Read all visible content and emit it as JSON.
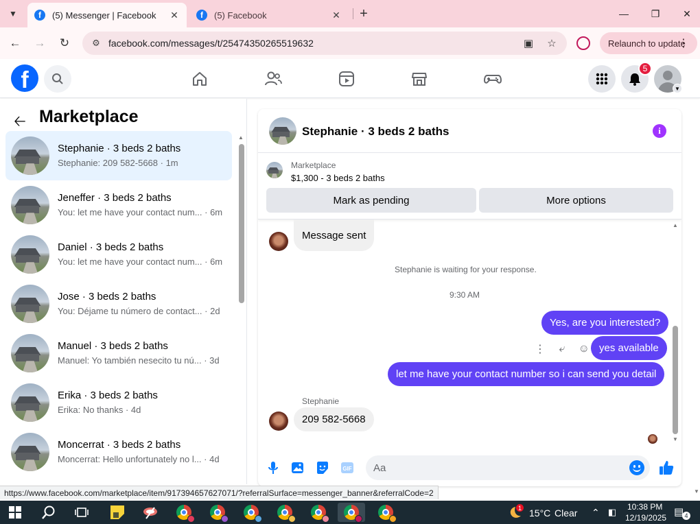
{
  "browser": {
    "tabs": [
      {
        "title": "(5) Messenger | Facebook",
        "active": true
      },
      {
        "title": "(5) Facebook",
        "active": false
      }
    ],
    "url": "facebook.com/messages/t/25474350265519632",
    "relaunch_label": "Relaunch to update",
    "status_url": "https://www.facebook.com/marketplace/item/917394657627071/?referralSurface=messenger_banner&referralCode=2"
  },
  "fbnav": {
    "logo_letter": "f",
    "notifications_count": "5",
    "brand_color": "#0866ff"
  },
  "left": {
    "title": "Marketplace",
    "conversations": [
      {
        "name": "Stephanie · 3 beds 2 baths",
        "preview": "Stephanie: 209 582-5668 · 1m",
        "selected": true
      },
      {
        "name": "Jeneffer · 3 beds 2 baths",
        "preview": "You: let me have your contact num... · 6m"
      },
      {
        "name": "Daniel · 3 beds 2 baths",
        "preview": "You: let me have your contact num... · 6m"
      },
      {
        "name": "Jose · 3 beds 2 baths",
        "preview": "You: Déjame tu número de contact... · 2d"
      },
      {
        "name": "Manuel · 3 beds 2 baths",
        "preview": "Manuel: Yo también nesecito tu nú... · 3d"
      },
      {
        "name": "Erika · 3 beds 2 baths",
        "preview": "Erika: No thanks · 4d"
      },
      {
        "name": "Moncerrat · 3 beds 2 baths",
        "preview": "Moncerrat: Hello unfortunately no l... · 4d"
      }
    ]
  },
  "chat": {
    "title": "Stephanie · 3 beds 2 baths",
    "marketplace": {
      "source": "Marketplace",
      "price_line": "$1,300 - 3 beds 2 baths",
      "mark_pending_label": "Mark as pending",
      "more_options_label": "More options"
    },
    "messages": {
      "in1": "Message sent",
      "waiting": "Stephanie is waiting for your response.",
      "time": "9:30 AM",
      "out1": "Yes, are you interested?",
      "out2": "yes available",
      "out3": "let me have your contact number so i can send you detail",
      "sender": "Stephanie",
      "in2": "209 582-5668"
    },
    "composer_placeholder": "Aa",
    "outgoing_color": "#6042f5",
    "accent_color": "#0a7cff"
  },
  "taskbar": {
    "weather_temp": "15°C",
    "weather_desc": "Clear",
    "time": "10:38 PM",
    "date": "12/19/2025",
    "notification_count": "4",
    "weather_badge": "1"
  }
}
